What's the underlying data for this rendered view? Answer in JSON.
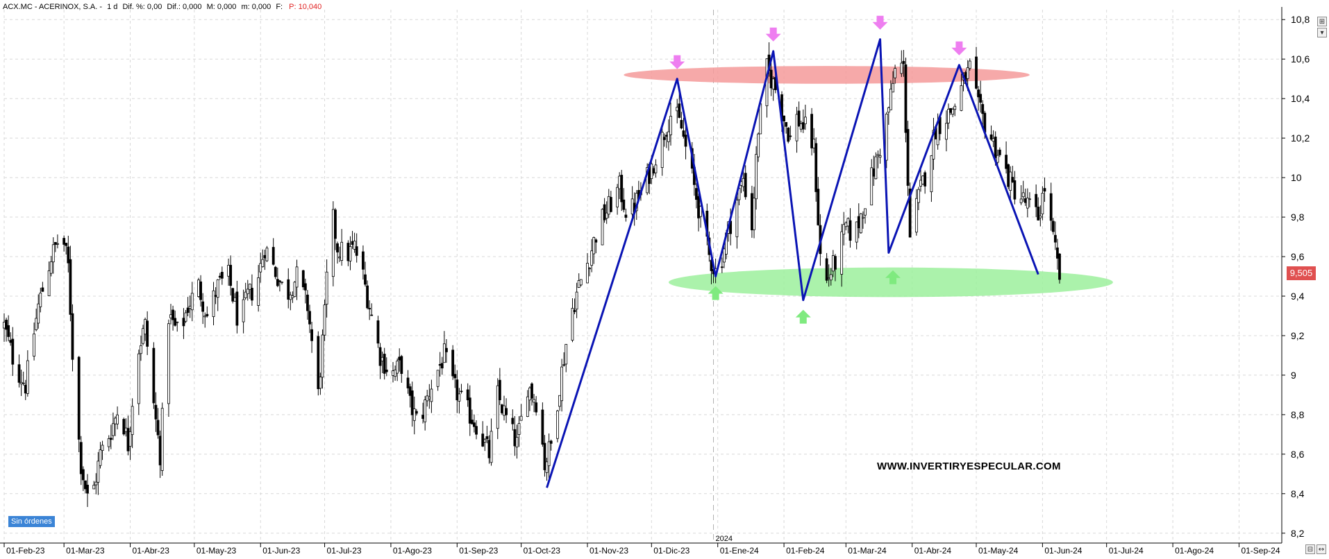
{
  "header": {
    "symbol": "ACX.MC - ACERINOX, S.A. -",
    "period": "1 d",
    "diff_pct": "Dif. %: 0,00",
    "diff": "Dif.: 0,000",
    "max": "M: 0,000",
    "min": "m: 0,000",
    "f_label": "F:",
    "price": "P: 10,040",
    "price_color": "#e02020"
  },
  "last_price_badge": {
    "text": "9,505",
    "color": "#e05050",
    "value": 9.505
  },
  "orders_label": "Sin órdenes",
  "watermark": "WWW.INVERTIRYESPECULAR.COM",
  "year_marker": "2024",
  "side_buttons": [
    {
      "glyph": "⊞",
      "name": "layout-grid-icon"
    },
    {
      "glyph": "▾",
      "name": "dropdown-arrow-icon"
    }
  ],
  "bottom_buttons": [
    {
      "glyph": "⊟",
      "name": "save-chart-icon"
    },
    {
      "glyph": "↔",
      "name": "scroll-arrow-icon"
    }
  ],
  "colors": {
    "candle": "#000000",
    "zigzag": "#0a14b4",
    "resistance_zone": "#f59a9a",
    "support_zone": "#9cf09c",
    "top_arrow": "#ee7ef0",
    "bottom_arrow": "#7fea7f",
    "grid": "#d8d8d8"
  },
  "chart_data": {
    "type": "candlestick",
    "title": "",
    "xlabel": "",
    "ylabel": "",
    "ylim": [
      8.15,
      10.85
    ],
    "y_ticks": [
      8.2,
      8.4,
      8.6,
      8.8,
      9.0,
      9.2,
      9.4,
      9.6,
      9.8,
      10.0,
      10.2,
      10.4,
      10.6,
      10.8
    ],
    "y_tick_labels": [
      "8,2",
      "8,4",
      "8,6",
      "8,8",
      "9",
      "9,2",
      "9,4",
      "9,6",
      "9,8",
      "10",
      "10,2",
      "10,4",
      "10,6",
      "10,8"
    ],
    "grid": true,
    "x_tick_labels": [
      "01-Feb-23",
      "01-Mar-23",
      "01-Abr-23",
      "01-May-23",
      "01-Jun-23",
      "01-Jul-23",
      "01-Ago-23",
      "01-Sep-23",
      "01-Oct-23",
      "01-Nov-23",
      "01-Dic-23",
      "01-Ene-24",
      "01-Feb-24",
      "01-Mar-24",
      "01-Abr-24",
      "01-May-24",
      "01-Jun-24",
      "01-Jul-24",
      "01-Ago-24",
      "01-Sep-24"
    ],
    "x_tick_days": [
      0,
      28,
      59,
      89,
      120,
      150,
      181,
      212,
      242,
      273,
      303,
      334,
      365,
      394,
      425,
      455,
      486,
      516,
      547,
      578
    ],
    "x_max_day": 598,
    "year_marker_day": 332,
    "close_path": [
      [
        0,
        9.25
      ],
      [
        5,
        9.05
      ],
      [
        10,
        8.95
      ],
      [
        16,
        9.35
      ],
      [
        22,
        9.6
      ],
      [
        27,
        9.72
      ],
      [
        30,
        9.55
      ],
      [
        33,
        8.9
      ],
      [
        36,
        8.55
      ],
      [
        40,
        8.32
      ],
      [
        45,
        8.6
      ],
      [
        50,
        8.72
      ],
      [
        54,
        8.85
      ],
      [
        58,
        8.65
      ],
      [
        62,
        9.1
      ],
      [
        66,
        9.25
      ],
      [
        70,
        8.85
      ],
      [
        73,
        8.6
      ],
      [
        77,
        9.3
      ],
      [
        82,
        9.2
      ],
      [
        86,
        9.35
      ],
      [
        91,
        9.45
      ],
      [
        95,
        9.3
      ],
      [
        100,
        9.45
      ],
      [
        105,
        9.5
      ],
      [
        110,
        9.25
      ],
      [
        114,
        9.4
      ],
      [
        118,
        9.45
      ],
      [
        122,
        9.65
      ],
      [
        126,
        9.55
      ],
      [
        132,
        9.4
      ],
      [
        137,
        9.5
      ],
      [
        142,
        9.35
      ],
      [
        147,
        8.9
      ],
      [
        150,
        9.3
      ],
      [
        153,
        9.85
      ],
      [
        156,
        9.65
      ],
      [
        160,
        9.6
      ],
      [
        164,
        9.65
      ],
      [
        168,
        9.5
      ],
      [
        171,
        9.35
      ],
      [
        176,
        9.1
      ],
      [
        181,
        9.0
      ],
      [
        186,
        9.05
      ],
      [
        190,
        8.85
      ],
      [
        194,
        8.75
      ],
      [
        200,
        8.95
      ],
      [
        206,
        9.1
      ],
      [
        210,
        8.95
      ],
      [
        215,
        8.85
      ],
      [
        221,
        8.75
      ],
      [
        227,
        8.6
      ],
      [
        231,
        8.9
      ],
      [
        236,
        8.75
      ],
      [
        240,
        8.65
      ],
      [
        245,
        8.95
      ],
      [
        250,
        8.85
      ],
      [
        253,
        8.55
      ],
      [
        256,
        8.65
      ],
      [
        260,
        8.95
      ],
      [
        265,
        9.3
      ],
      [
        269,
        9.45
      ],
      [
        274,
        9.6
      ],
      [
        278,
        9.75
      ],
      [
        283,
        9.85
      ],
      [
        288,
        9.95
      ],
      [
        292,
        9.8
      ],
      [
        297,
        9.9
      ],
      [
        303,
        10.05
      ],
      [
        308,
        10.2
      ],
      [
        313,
        10.35
      ],
      [
        317,
        10.25
      ],
      [
        321,
        10.05
      ],
      [
        325,
        9.85
      ],
      [
        330,
        9.6
      ],
      [
        334,
        9.5
      ],
      [
        338,
        9.7
      ],
      [
        342,
        9.85
      ],
      [
        346,
        10.0
      ],
      [
        350,
        9.75
      ],
      [
        353,
        10.25
      ],
      [
        357,
        10.55
      ],
      [
        361,
        10.45
      ],
      [
        365,
        10.3
      ],
      [
        368,
        10.2
      ],
      [
        371,
        10.3
      ],
      [
        375,
        10.25
      ],
      [
        379,
        10.15
      ],
      [
        383,
        9.42
      ],
      [
        386,
        9.5
      ],
      [
        390,
        9.6
      ],
      [
        394,
        9.75
      ],
      [
        398,
        9.7
      ],
      [
        402,
        9.85
      ],
      [
        406,
        10.0
      ],
      [
        410,
        10.15
      ],
      [
        414,
        10.35
      ],
      [
        418,
        10.6
      ],
      [
        421,
        10.55
      ],
      [
        424,
        9.7
      ],
      [
        428,
        9.9
      ],
      [
        432,
        10.05
      ],
      [
        436,
        10.25
      ],
      [
        440,
        10.3
      ],
      [
        444,
        10.35
      ],
      [
        448,
        10.45
      ],
      [
        452,
        10.55
      ],
      [
        456,
        10.35
      ],
      [
        460,
        10.25
      ],
      [
        464,
        10.15
      ],
      [
        468,
        10.05
      ],
      [
        472,
        9.95
      ],
      [
        476,
        9.9
      ],
      [
        480,
        9.85
      ],
      [
        484,
        9.8
      ],
      [
        487,
        9.95
      ],
      [
        490,
        9.75
      ],
      [
        494,
        9.5
      ]
    ],
    "zigzag_points": [
      [
        254,
        8.43
      ],
      [
        315,
        10.5
      ],
      [
        333,
        9.5
      ],
      [
        360,
        10.64
      ],
      [
        374,
        9.38
      ],
      [
        410,
        10.7
      ],
      [
        414,
        9.62
      ],
      [
        447,
        10.57
      ],
      [
        484,
        9.51
      ]
    ],
    "resistance_zone": {
      "day_from": 290,
      "day_to": 480,
      "y": 10.52,
      "half_height": 0.045
    },
    "support_zone": {
      "day_from": 311,
      "day_to": 519,
      "y": 9.47,
      "half_height": 0.075
    },
    "top_arrows_days": [
      315,
      360,
      410,
      447
    ],
    "bottom_arrows_days": [
      333,
      374,
      416
    ]
  }
}
